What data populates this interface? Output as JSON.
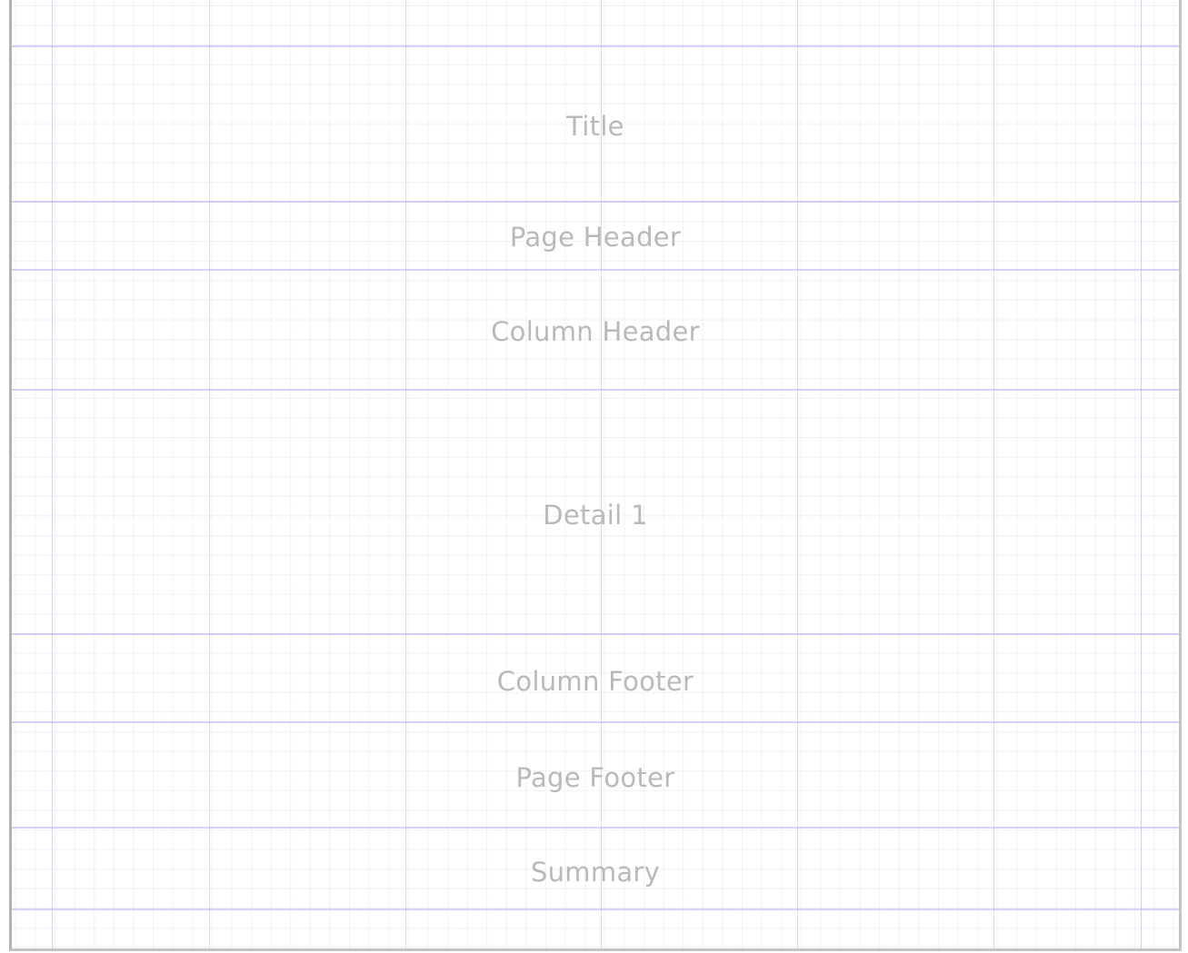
{
  "bands": [
    {
      "id": "title",
      "label": "Title"
    },
    {
      "id": "page-header",
      "label": "Page Header"
    },
    {
      "id": "column-header",
      "label": "Column Header"
    },
    {
      "id": "detail-1",
      "label": "Detail 1"
    },
    {
      "id": "column-footer",
      "label": "Column Footer"
    },
    {
      "id": "page-footer",
      "label": "Page Footer"
    },
    {
      "id": "summary",
      "label": "Summary"
    }
  ]
}
